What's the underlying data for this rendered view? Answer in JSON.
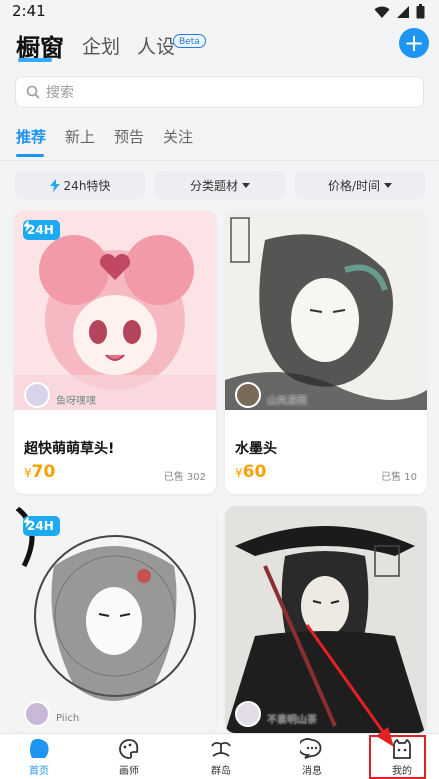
{
  "status": {
    "time": "2:41"
  },
  "header": {
    "brand": "橱窗",
    "tabs": [
      "企划",
      "人设"
    ],
    "beta": "Beta",
    "add": "+"
  },
  "search": {
    "placeholder": "搜索"
  },
  "subtabs": [
    "推荐",
    "新上",
    "预告",
    "关注"
  ],
  "filters": {
    "fast": "24h特快",
    "category": "分类题材",
    "price": "价格/时间"
  },
  "cards": [
    {
      "badge": "24H",
      "artist": "鱼呀嘿嘿",
      "title": "超快萌萌草头!",
      "price_symbol": "¥",
      "price": "70",
      "sold": "已售 302"
    },
    {
      "badge": "",
      "artist": "山岚潇雨",
      "title": "水墨头",
      "price_symbol": "¥",
      "price": "60",
      "sold": "已售 10"
    },
    {
      "badge": "24H",
      "artist": "Piich",
      "title": "",
      "price_symbol": "",
      "price": "",
      "sold": ""
    },
    {
      "badge": "",
      "artist": "不素明山茶",
      "title": "",
      "price_symbol": "",
      "price": "",
      "sold": ""
    }
  ],
  "bottom_nav": [
    "首页",
    "画师",
    "群岛",
    "消息",
    "我的"
  ],
  "colors": {
    "accent": "#1f95f2",
    "price": "#f5a100",
    "highlight": "#e42020"
  }
}
